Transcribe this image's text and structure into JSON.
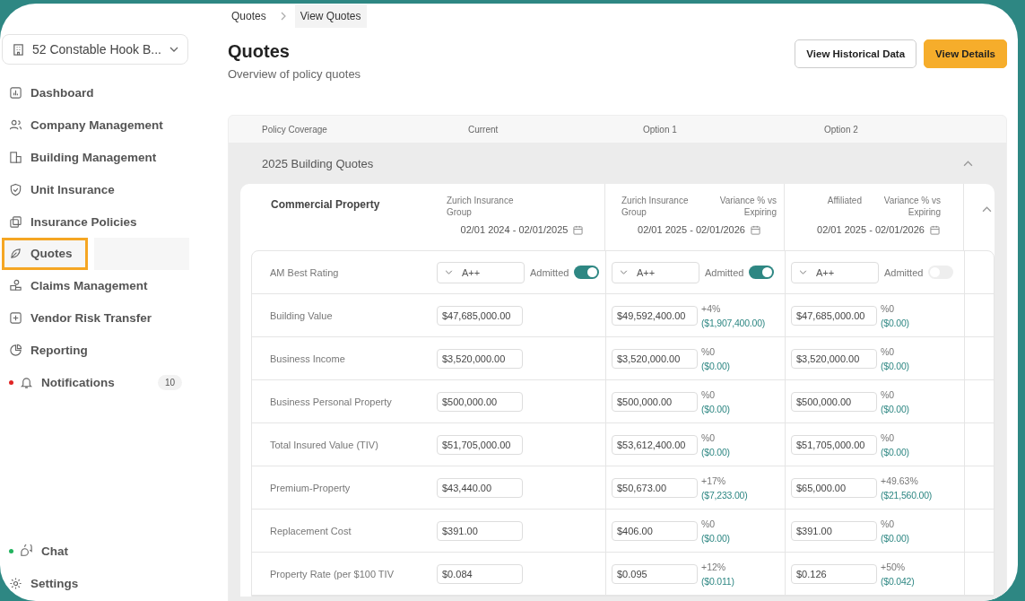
{
  "building_selector": {
    "label": "52 Constable Hook B..."
  },
  "nav": [
    {
      "label": "Dashboard",
      "selected": false
    },
    {
      "label": "Company Management",
      "selected": false
    },
    {
      "label": "Building Management",
      "selected": false
    },
    {
      "label": "Unit Insurance",
      "selected": false
    },
    {
      "label": "Insurance Policies",
      "selected": false
    },
    {
      "label": "Quotes",
      "selected": true
    },
    {
      "label": "Claims Management",
      "selected": false
    },
    {
      "label": "Vendor Risk Transfer",
      "selected": false
    },
    {
      "label": "Reporting",
      "selected": false
    },
    {
      "label": "Notifications",
      "selected": false,
      "color": "#e02424",
      "badge": "10"
    }
  ],
  "bottom_nav": [
    {
      "label": "Chat",
      "selected": false,
      "color": "#22b35e"
    },
    {
      "label": "Settings",
      "selected": false
    }
  ],
  "breadcrumbs": [
    "Quotes",
    "View Quotes"
  ],
  "title": "Quotes",
  "subtitle": "Overview of policy quotes",
  "buttons": [
    {
      "label": "View Historical Data",
      "kind": "secondary"
    },
    {
      "label": "View Details",
      "kind": "primary"
    }
  ],
  "columns": [
    "Policy Coverage",
    "Current",
    "Option 1",
    "Option 2"
  ],
  "section": {
    "title": "2025 Building Quotes",
    "expanded": true
  },
  "card": {
    "title": "Commercial Property",
    "expanded": true,
    "quotes": [
      {
        "carrier": "Zurich Insurance Group",
        "dates": "02/01 2024 - 02/01/2025"
      },
      {
        "carrier": "Zurich Insurance Group",
        "variance_label": "Variance % vs Expiring",
        "dates": "02/01 2025 - 02/01/2026"
      },
      {
        "carrier": "Affiliated",
        "variance_label": "Variance % vs Expiring",
        "dates": "02/01 2025 - 02/01/2026"
      }
    ],
    "rating": {
      "label": "AM Best Rating",
      "cells": [
        {
          "value": "A++",
          "toggle_label": "Admitted",
          "on": true
        },
        {
          "value": "A++",
          "toggle_label": "Admitted",
          "on": true
        },
        {
          "value": "A++",
          "toggle_label": "Admitted",
          "on": false
        }
      ]
    },
    "rows": [
      {
        "label": "Building Value",
        "current": "$47,685,000.00",
        "options": [
          {
            "value": "$49,592,400.00",
            "pct": "+4%",
            "amount": "($1,907,400.00)"
          },
          {
            "value": "$47,685,000.00",
            "pct": "%0",
            "amount": "($0.00)"
          }
        ]
      },
      {
        "label": "Business Income",
        "current": "$3,520,000.00",
        "options": [
          {
            "value": "$3,520,000.00",
            "pct": "%0",
            "amount": "($0.00)"
          },
          {
            "value": "$3,520,000.00",
            "pct": "%0",
            "amount": "($0.00)"
          }
        ]
      },
      {
        "label": "Business Personal Property",
        "current": "$500,000.00",
        "options": [
          {
            "value": "$500,000.00",
            "pct": "%0",
            "amount": "($0.00)"
          },
          {
            "value": "$500,000.00",
            "pct": "%0",
            "amount": "($0.00)"
          }
        ]
      },
      {
        "label": "Total Insured Value (TIV)",
        "current": "$51,705,000.00",
        "options": [
          {
            "value": "$53,612,400.00",
            "pct": "%0",
            "amount": "($0.00)"
          },
          {
            "value": "$51,705,000.00",
            "pct": "%0",
            "amount": "($0.00)"
          }
        ]
      },
      {
        "label": "Premium-Property",
        "current": "$43,440.00",
        "options": [
          {
            "value": "$50,673.00",
            "pct": "+17%",
            "amount": "($7,233.00)"
          },
          {
            "value": "$65,000.00",
            "pct": "+49.63%",
            "amount": "($21,560.00)"
          }
        ]
      },
      {
        "label": "Replacement Cost",
        "current": "$391.00",
        "options": [
          {
            "value": "$406.00",
            "pct": "%0",
            "amount": "($0.00)"
          },
          {
            "value": "$391.00",
            "pct": "%0",
            "amount": "($0.00)"
          }
        ]
      },
      {
        "label": "Property Rate (per $100 TIV",
        "current": "$0.084",
        "options": [
          {
            "value": "$0.095",
            "pct": "+12%",
            "amount": "($0.011)"
          },
          {
            "value": "$0.126",
            "pct": "+50%",
            "amount": "($0.042)"
          }
        ]
      }
    ]
  }
}
